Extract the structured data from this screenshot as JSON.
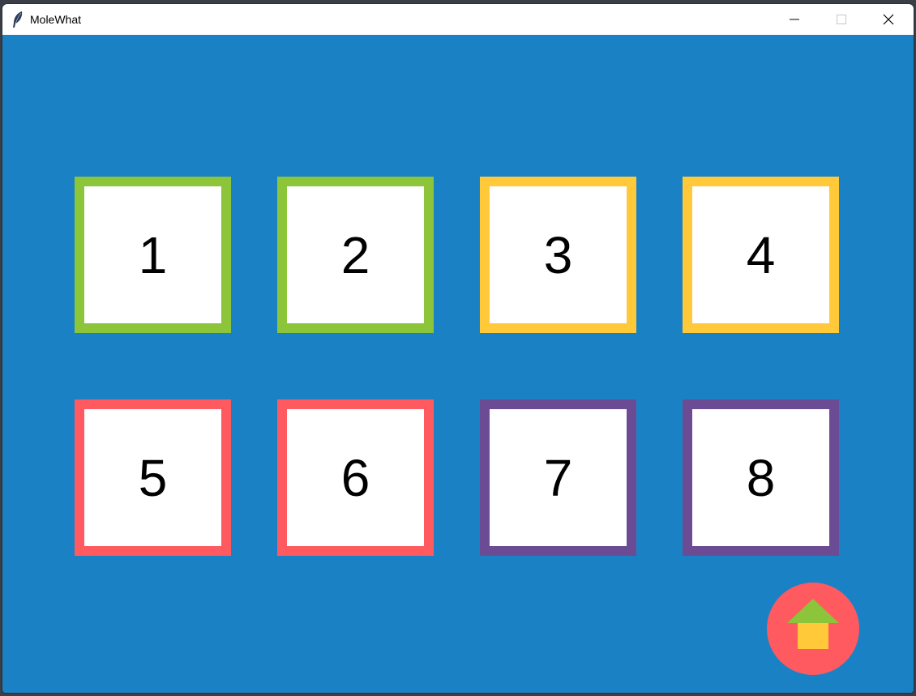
{
  "window": {
    "title": "MoleWhat",
    "controls": {
      "minimize_icon": "minimize-icon",
      "maximize_icon": "maximize-icon",
      "close_icon": "close-icon"
    }
  },
  "colors": {
    "background": "#1a82c4",
    "green": "#8cc43a",
    "yellow": "#ffc93a",
    "red": "#ff5a5f",
    "purple": "#6b4c94",
    "tile_fill": "#ffffff"
  },
  "tiles": [
    {
      "label": "1",
      "border_color": "#8cc43a"
    },
    {
      "label": "2",
      "border_color": "#8cc43a"
    },
    {
      "label": "3",
      "border_color": "#ffc93a"
    },
    {
      "label": "4",
      "border_color": "#ffc93a"
    },
    {
      "label": "5",
      "border_color": "#ff5a5f"
    },
    {
      "label": "6",
      "border_color": "#ff5a5f"
    },
    {
      "label": "7",
      "border_color": "#6b4c94"
    },
    {
      "label": "8",
      "border_color": "#6b4c94"
    }
  ],
  "home_button": {
    "icon": "home-icon",
    "circle_color": "#ff5a5f",
    "roof_color": "#8cc43a",
    "body_color": "#ffc93a"
  }
}
